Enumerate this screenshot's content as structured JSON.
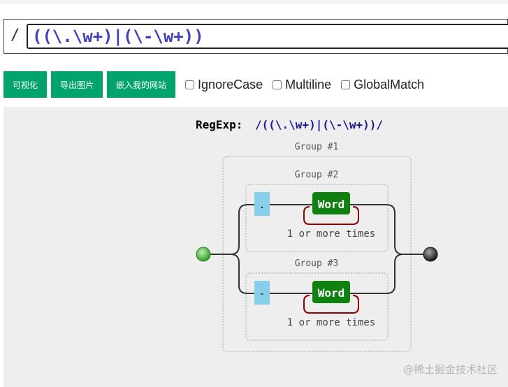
{
  "input": {
    "prefix": "/",
    "value": "((\\.\\w+)|(\\-\\w+))"
  },
  "toolbar": {
    "visualize_label": "可视化",
    "export_label": "导出图片",
    "embed_label": "嵌入我的网站"
  },
  "flags": [
    {
      "label": "IgnoreCase",
      "checked": false
    },
    {
      "label": "Multiline",
      "checked": false
    },
    {
      "label": "GlobalMatch",
      "checked": false
    }
  ],
  "diagram": {
    "regexp_label": "RegExp:",
    "regexp_text": "/((\\.\\w+)|(\\-\\w+))/",
    "group1_label": "Group #1",
    "group2_label": "Group #2",
    "group3_label": "Group #3",
    "literal_dot": ".",
    "literal_dash": "-",
    "word_label_1": "Word",
    "word_label_2": "Word",
    "repeat_label_1": "1 or more times",
    "repeat_label_2": "1 or more times",
    "watermark": "@稀土掘金技术社区",
    "colors": {
      "start_node": "#55c24b",
      "end_node": "#333333",
      "word_fill": "#108010",
      "literal_fill": "#87ceeb",
      "loop_stroke": "#8b0000",
      "group_border": "#bbbbbb"
    }
  }
}
